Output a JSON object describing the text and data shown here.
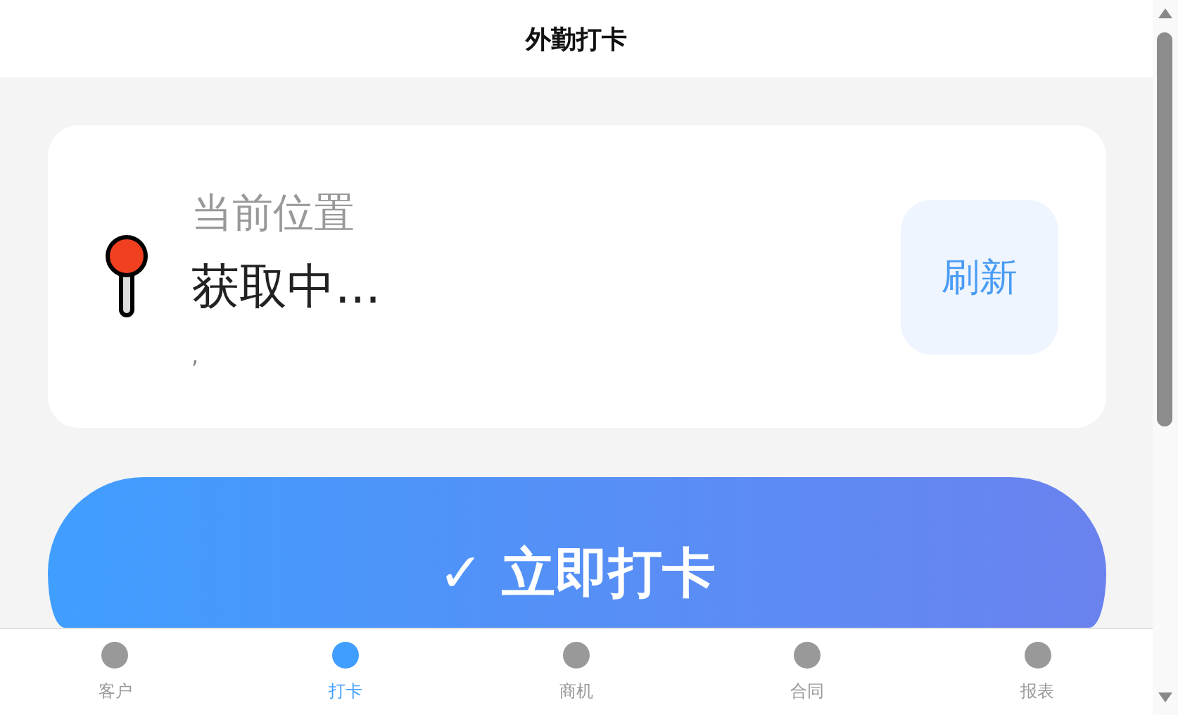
{
  "header": {
    "title": "外勤打卡"
  },
  "location_card": {
    "label": "当前位置",
    "value": "获取中...",
    "coordinates": ",",
    "refresh_button": "刷新"
  },
  "check_in_button": "✓ 立即打卡",
  "tab_bar": [
    {
      "label": "客户",
      "selected": false
    },
    {
      "label": "打卡",
      "selected": true
    },
    {
      "label": "商机",
      "selected": false
    },
    {
      "label": "合同",
      "selected": false
    },
    {
      "label": "报表",
      "selected": false
    }
  ]
}
